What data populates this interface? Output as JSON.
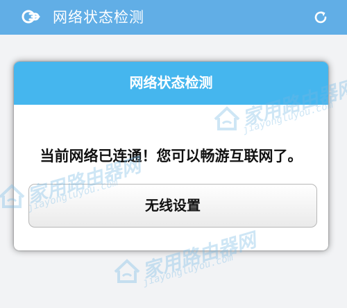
{
  "header": {
    "title": "网络状态检测"
  },
  "dialog": {
    "title": "网络状态检测",
    "message": "当前网络已连通！您可以畅游互联网了。",
    "button_label": "无线设置"
  },
  "watermark": {
    "title": "家用路由器网",
    "url": "jiayongluyou.com"
  },
  "colors": {
    "header_bg": "#61aee6",
    "dialog_header_bg": "#45b6ee",
    "page_bg": "#f2f3f5",
    "watermark": "#74b8e5"
  },
  "icons": {
    "logo": "link-icon",
    "refresh": "refresh-icon",
    "watermark_logo": "house-wifi-icon"
  }
}
